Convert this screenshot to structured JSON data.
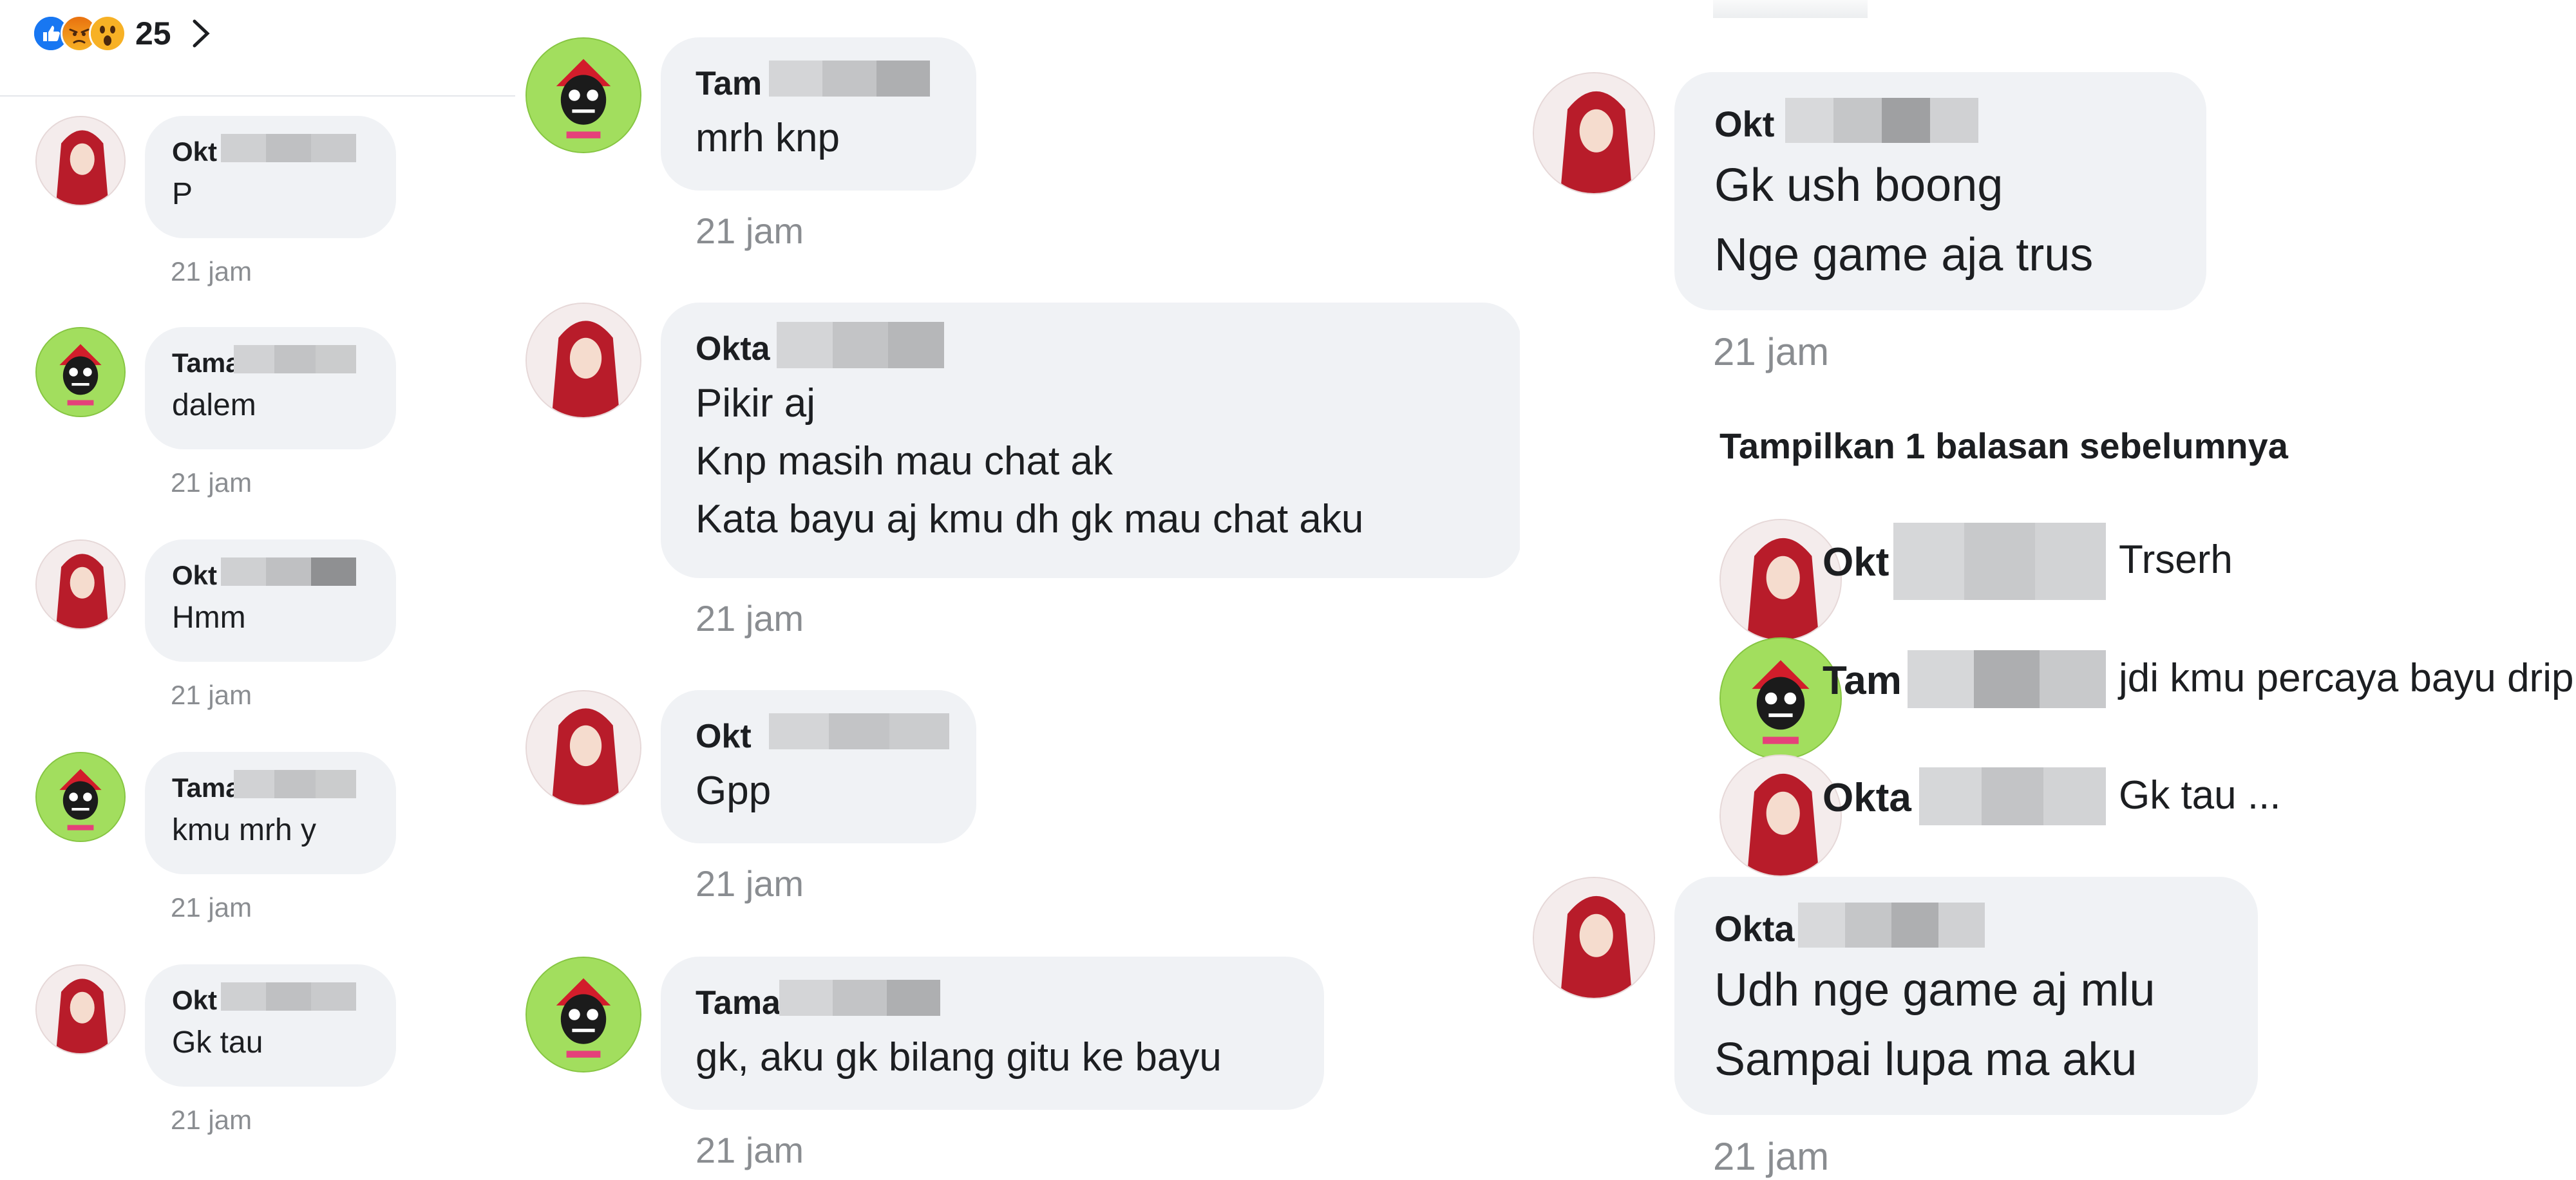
{
  "colors": {
    "bubble": "#f0f2f5",
    "time": "#8a8d91",
    "like": "#1877f2",
    "angry": "#e9710f",
    "wow": "#f7b125"
  },
  "reactions": {
    "icons": [
      "like-icon",
      "angry-icon",
      "wow-icon"
    ],
    "count": "25"
  },
  "panel1": {
    "comments": [
      {
        "name": "Okt",
        "text": "P",
        "time": "21 jam",
        "avatar": "okta"
      },
      {
        "name": "Tama",
        "text": "dalem",
        "time": "21 jam",
        "avatar": "tama"
      },
      {
        "name": "Okt",
        "text": "Hmm",
        "time": "21 jam",
        "avatar": "okta"
      },
      {
        "name": "Tama",
        "text": "kmu mrh y",
        "time": "21 jam",
        "avatar": "tama"
      },
      {
        "name": "Okt",
        "text": "Gk tau",
        "time": "21 jam",
        "avatar": "okta"
      }
    ]
  },
  "panel2": {
    "comments": [
      {
        "name": "Tam",
        "text": "mrh knp",
        "time": "21 jam",
        "avatar": "tama"
      },
      {
        "name": "Okta",
        "text": "Pikir aj\nKnp masih mau chat ak\nKata bayu aj kmu dh gk mau chat aku",
        "time": "21 jam",
        "avatar": "okta"
      },
      {
        "name": "Okt",
        "text": "Gpp",
        "time": "21 jam",
        "avatar": "okta"
      },
      {
        "name": "Tama",
        "text": "gk, aku gk bilang gitu ke bayu",
        "time": "21 jam",
        "avatar": "tama"
      }
    ]
  },
  "panel3": {
    "comments_top": [
      {
        "name": "Okt",
        "text": "Gk ush boong\nNge game aja trus",
        "time": "21 jam",
        "avatar": "okta"
      }
    ],
    "show_previous": "Tampilkan 1 balasan sebelumnya",
    "replies": [
      {
        "name": "Okt",
        "text": "Trserh",
        "avatar": "okta"
      },
      {
        "name": "Tam",
        "text": "jdi kmu percaya bayu drip",
        "avatar": "tama"
      },
      {
        "name": "Okta",
        "text": "Gk tau ...",
        "avatar": "okta"
      }
    ],
    "comments_bottom": [
      {
        "name": "Okta",
        "text": "Udh nge game aj mlu\nSampai lupa ma aku",
        "time": "21 jam",
        "avatar": "okta"
      }
    ]
  }
}
